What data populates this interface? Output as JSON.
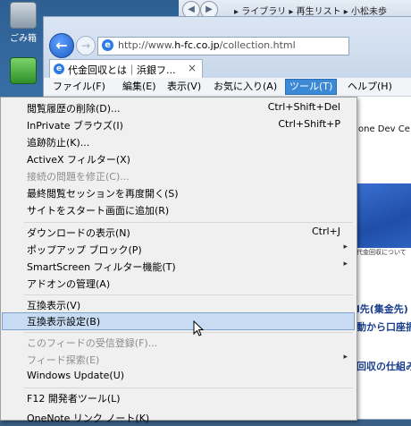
{
  "desktop": {
    "icons": [
      {
        "label": "ごみ箱"
      },
      {
        "label": ""
      }
    ]
  },
  "explorer": {
    "breadcrumb": "▸ ライブラリ ▸ 再生リスト ▸ 小松未歩"
  },
  "browser": {
    "url_prefix": "http://www.",
    "url_domain": "h-fc.co.jp",
    "url_suffix": "/collection.html",
    "tab_title": "代金回収とは｜浜銀フ...",
    "tab_close": "×",
    "menu": [
      {
        "label": "ファイル(F)"
      },
      {
        "label": "編集(E)"
      },
      {
        "label": "表示(V)"
      },
      {
        "label": "お気に入り(A)"
      },
      {
        "label": "ツール(T)"
      },
      {
        "label": "ヘルプ(H)"
      }
    ]
  },
  "page": {
    "partial_text_1": "one Dev Ce",
    "banner_note": "代金回収について",
    "blue_text_1": "l先(集金先)",
    "blue_text_2": "動から口座振",
    "blue_text_3": "回収の仕組み"
  },
  "tools_menu": {
    "items": [
      {
        "label": "閲覧履歴の削除(D)...",
        "shortcut": "Ctrl+Shift+Del"
      },
      {
        "label": "InPrivate ブラウズ(I)",
        "shortcut": "Ctrl+Shift+P"
      },
      {
        "label": "追跡防止(K)...",
        "shortcut": ""
      },
      {
        "label": "ActiveX フィルター(X)",
        "shortcut": ""
      },
      {
        "label": "接続の問題を修正(C)...",
        "shortcut": "",
        "disabled": true
      },
      {
        "label": "最終閲覧セッションを再度開く(S)",
        "shortcut": ""
      },
      {
        "label": "サイトをスタート画面に追加(R)",
        "shortcut": ""
      },
      {
        "label": "ダウンロードの表示(N)",
        "shortcut": "Ctrl+J"
      },
      {
        "label": "ポップアップ ブロック(P)",
        "shortcut": "",
        "submenu": true
      },
      {
        "label": "SmartScreen フィルター機能(T)",
        "shortcut": "",
        "submenu": true
      },
      {
        "label": "アドオンの管理(A)",
        "shortcut": ""
      },
      {
        "label": "互換表示(V)",
        "shortcut": ""
      },
      {
        "label": "互換表示設定(B)",
        "shortcut": "",
        "highlighted": true
      },
      {
        "label": "このフィードの受信登録(F)...",
        "shortcut": "",
        "disabled": true
      },
      {
        "label": "フィード探索(E)",
        "shortcut": "",
        "disabled": true,
        "submenu": true
      },
      {
        "label": "Windows Update(U)",
        "shortcut": ""
      },
      {
        "label": "F12 開発者ツール(L)",
        "shortcut": ""
      },
      {
        "label": "OneNote リンク ノート(K)",
        "shortcut": ""
      }
    ]
  },
  "colors": {
    "menu_active": "#3c8ad6",
    "item_highlight": "#c7dcf2"
  }
}
